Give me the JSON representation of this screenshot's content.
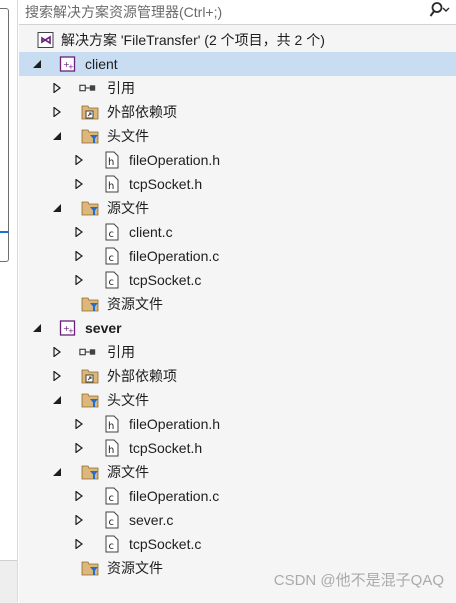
{
  "search": {
    "placeholder": "搜索解决方案资源管理器(Ctrl+;)"
  },
  "tree": {
    "solution": "解决方案 'FileTransfer' (2 个项目，共 2 个)",
    "client": {
      "name": "client",
      "references": "引用",
      "external": "外部依赖项",
      "headers": "头文件",
      "header_files": [
        "fileOperation.h",
        "tcpSocket.h"
      ],
      "sources": "源文件",
      "source_files": [
        "client.c",
        "fileOperation.c",
        "tcpSocket.c"
      ],
      "resources": "资源文件"
    },
    "sever": {
      "name": "sever",
      "references": "引用",
      "external": "外部依赖项",
      "headers": "头文件",
      "header_files": [
        "fileOperation.h",
        "tcpSocket.h"
      ],
      "sources": "源文件",
      "source_files": [
        "fileOperation.c",
        "sever.c",
        "tcpSocket.c"
      ],
      "resources": "资源文件"
    }
  },
  "watermark": "CSDN @他不是混子QAQ",
  "colors": {
    "selected_row": "#c9ddf2",
    "folder": "#dcb67a",
    "vs_purple": "#68217a"
  }
}
